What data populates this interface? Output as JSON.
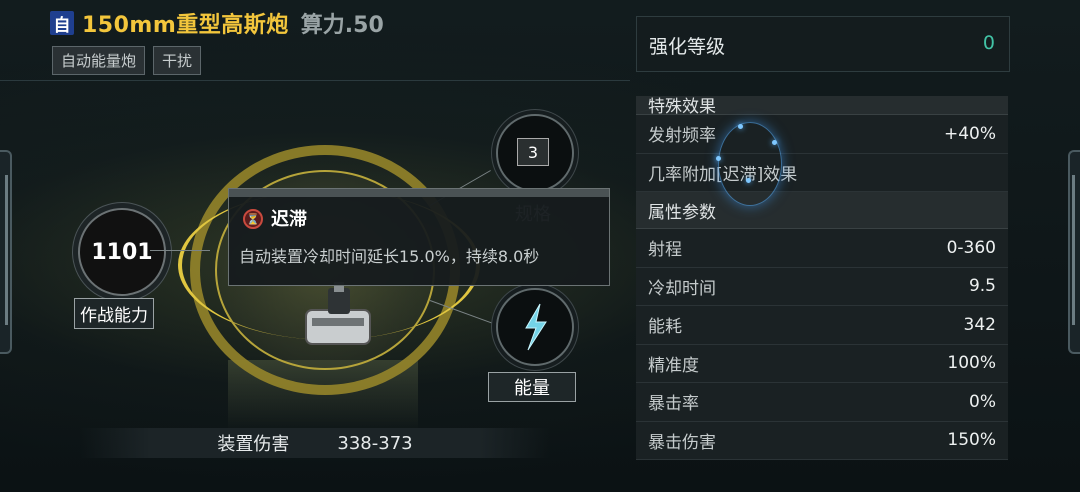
{
  "header": {
    "self_badge": "自",
    "title": "150mm重型高斯炮",
    "power": "算力.50",
    "tags": [
      "自动能量炮",
      "干扰"
    ]
  },
  "left_stat": {
    "value": "1101",
    "label": "作战能力"
  },
  "spec": {
    "value": "3",
    "label": "规格"
  },
  "energy": {
    "label": "能量"
  },
  "damage": {
    "label": "装置伤害",
    "value": "338-373"
  },
  "tooltip": {
    "title": "迟滞",
    "description": "自动装置冷却时间延长15.0%，持续8.0秒"
  },
  "enhance": {
    "label": "强化等级",
    "value": "0"
  },
  "special_section": {
    "title": "特殊效果",
    "rows": [
      {
        "key": "发射频率",
        "value": "+40%"
      },
      {
        "key": "几率附加[迟滞]效果",
        "value": ""
      }
    ]
  },
  "attr_section": {
    "title": "属性参数",
    "rows": [
      {
        "key": "射程",
        "value": "0-360"
      },
      {
        "key": "冷却时间",
        "value": "9.5"
      },
      {
        "key": "能耗",
        "value": "342"
      },
      {
        "key": "精准度",
        "value": "100%"
      },
      {
        "key": "暴击率",
        "value": "0%"
      },
      {
        "key": "暴击伤害",
        "value": "150%"
      }
    ]
  },
  "colors": {
    "title_gold": "#f3c63c",
    "enhance_value": "#42c3a6",
    "self_badge": "#1f3f8f"
  }
}
